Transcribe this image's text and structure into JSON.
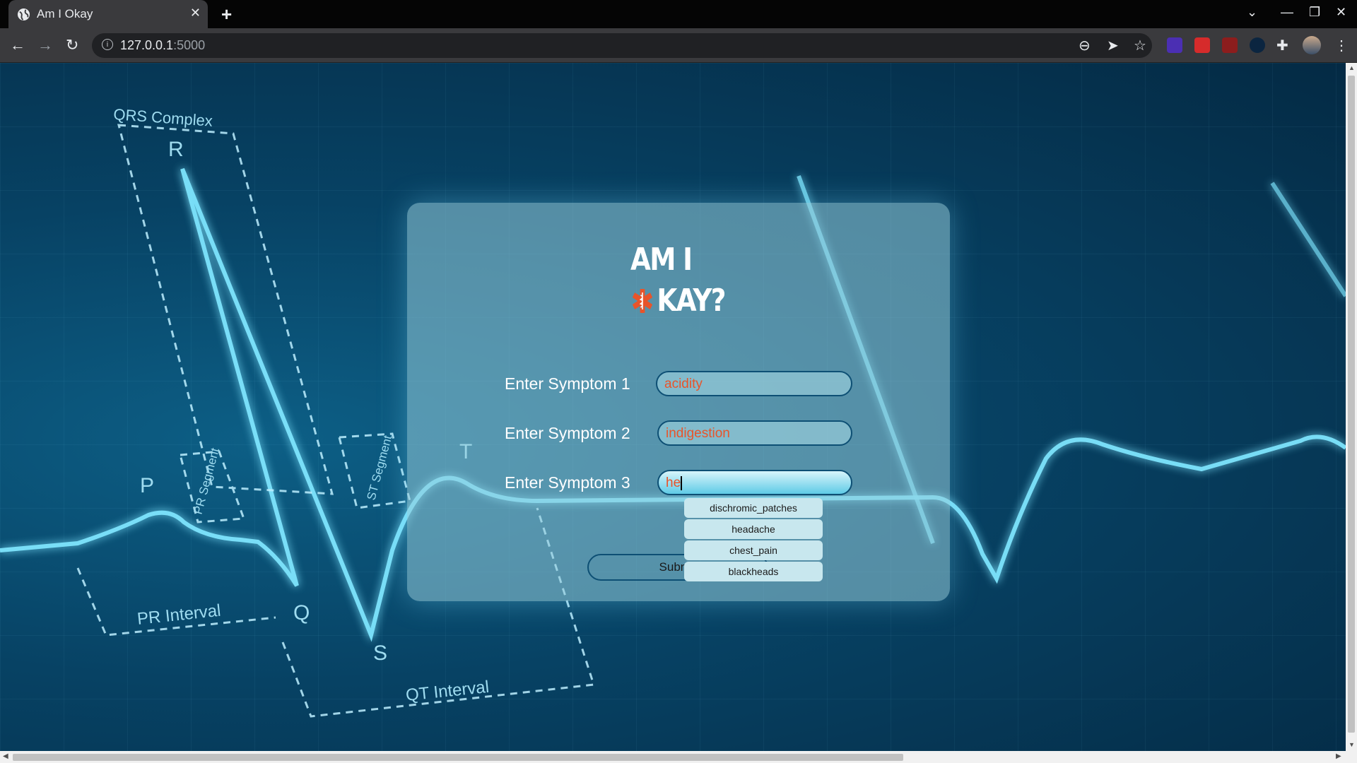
{
  "browser": {
    "tab_title": "Am I Okay",
    "url_host": "127.0.0.1",
    "url_port": ":5000"
  },
  "brand": {
    "line1": "AM I",
    "line2": "KAY?",
    "star_color": "#e8542a"
  },
  "ecg_labels": {
    "qrs": "QRS Complex",
    "r": "R",
    "p": "P",
    "q": "Q",
    "s": "S",
    "t": "T",
    "pr_segment": "PR Segment",
    "st_segment": "ST Segment",
    "pr_interval": "PR Interval",
    "qt_interval": "QT Interval"
  },
  "form": {
    "symptom1_label": "Enter Symptom 1",
    "symptom1_value": "acidity",
    "symptom2_label": "Enter Symptom 2",
    "symptom2_value": "indigestion",
    "symptom3_label": "Enter Symptom 3",
    "symptom3_value": "he",
    "submit_label": "Submit"
  },
  "autocomplete": [
    "dischromic_patches",
    "headache",
    "chest_pain",
    "blackheads"
  ]
}
